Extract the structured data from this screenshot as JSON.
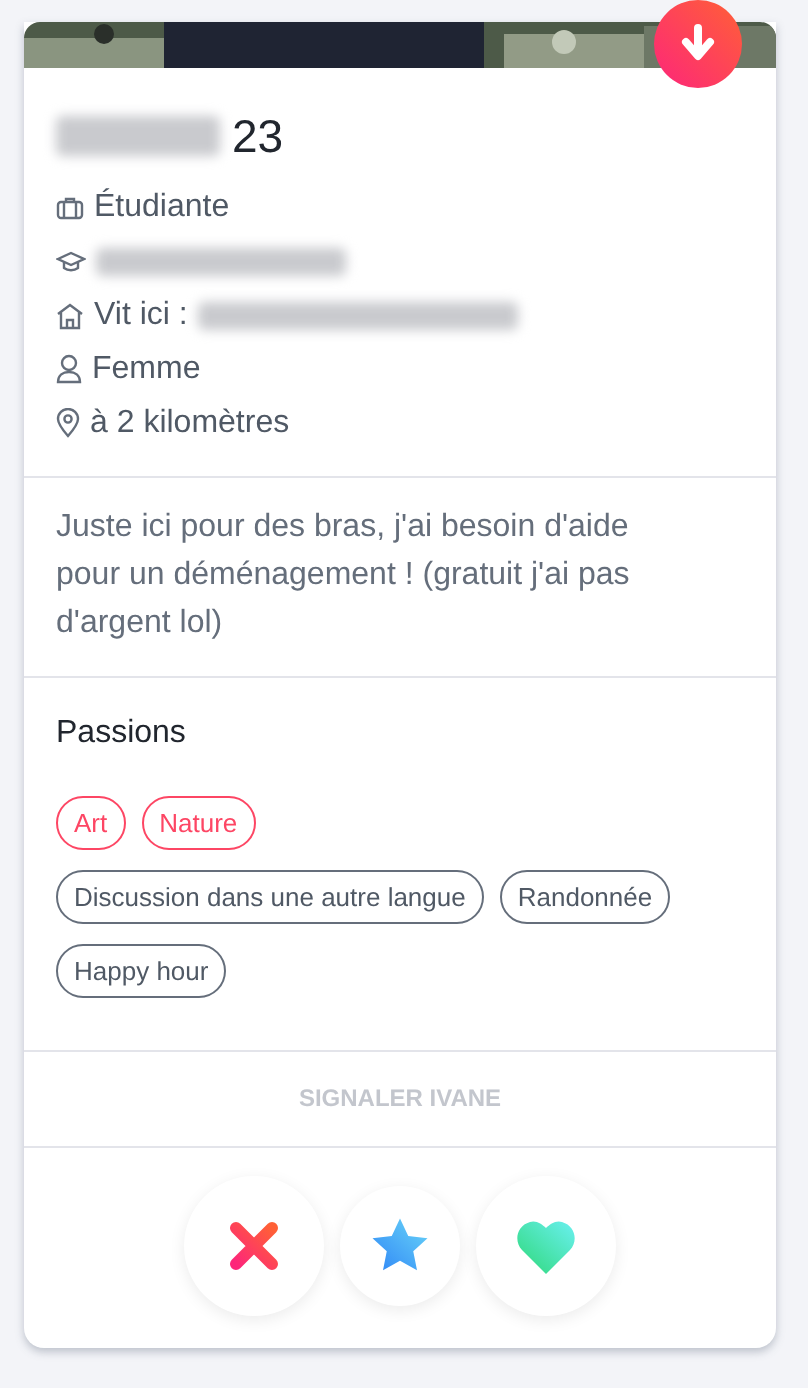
{
  "profile": {
    "age": "23",
    "name_redacted": true
  },
  "details": [
    {
      "kind": "job",
      "text": "Étudiante"
    },
    {
      "kind": "school",
      "redacted": true
    },
    {
      "kind": "home",
      "text": "Vit ici :",
      "redacted": true
    },
    {
      "kind": "gender",
      "text": "Femme"
    },
    {
      "kind": "distance",
      "text": "à 2 kilomètres"
    }
  ],
  "bio": "Juste ici pour des bras, j'ai besoin d'aide pour un déménagement ! (gratuit j'ai pas d'argent lol)",
  "passions": {
    "title": "Passions",
    "items": [
      {
        "label": "Art",
        "shared": true
      },
      {
        "label": "Nature",
        "shared": true
      },
      {
        "label": "Discussion dans une autre langue",
        "shared": false
      },
      {
        "label": "Randonnée",
        "shared": false
      },
      {
        "label": "Happy hour",
        "shared": false
      }
    ]
  },
  "report": "SIGNALER IVANE",
  "actions": [
    {
      "kind": "nope"
    },
    {
      "kind": "superlike"
    },
    {
      "kind": "like"
    }
  ]
}
